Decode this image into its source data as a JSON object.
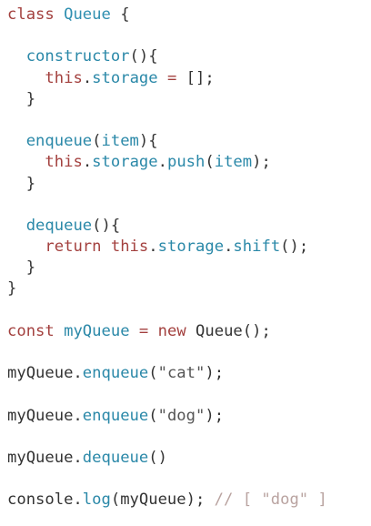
{
  "code": {
    "lines": [
      [
        {
          "t": "class",
          "c": "kw"
        },
        {
          "t": " ",
          "c": "pl"
        },
        {
          "t": "Queue",
          "c": "ty"
        },
        {
          "t": " {",
          "c": "pl"
        }
      ],
      [],
      [
        {
          "t": "  ",
          "c": "pl"
        },
        {
          "t": "constructor",
          "c": "fn"
        },
        {
          "t": "(){",
          "c": "pl"
        }
      ],
      [
        {
          "t": "    ",
          "c": "pl"
        },
        {
          "t": "this",
          "c": "kw"
        },
        {
          "t": ".",
          "c": "pl"
        },
        {
          "t": "storage",
          "c": "fn"
        },
        {
          "t": " ",
          "c": "pl"
        },
        {
          "t": "=",
          "c": "kw"
        },
        {
          "t": " [];",
          "c": "pl"
        }
      ],
      [
        {
          "t": "  }",
          "c": "pl"
        }
      ],
      [],
      [
        {
          "t": "  ",
          "c": "pl"
        },
        {
          "t": "enqueue",
          "c": "fn"
        },
        {
          "t": "(",
          "c": "pl"
        },
        {
          "t": "item",
          "c": "fn"
        },
        {
          "t": "){",
          "c": "pl"
        }
      ],
      [
        {
          "t": "    ",
          "c": "pl"
        },
        {
          "t": "this",
          "c": "kw"
        },
        {
          "t": ".",
          "c": "pl"
        },
        {
          "t": "storage",
          "c": "fn"
        },
        {
          "t": ".",
          "c": "pl"
        },
        {
          "t": "push",
          "c": "fn"
        },
        {
          "t": "(",
          "c": "pl"
        },
        {
          "t": "item",
          "c": "fn"
        },
        {
          "t": ");",
          "c": "pl"
        }
      ],
      [
        {
          "t": "  }",
          "c": "pl"
        }
      ],
      [],
      [
        {
          "t": "  ",
          "c": "pl"
        },
        {
          "t": "dequeue",
          "c": "fn"
        },
        {
          "t": "(){",
          "c": "pl"
        }
      ],
      [
        {
          "t": "    ",
          "c": "pl"
        },
        {
          "t": "return",
          "c": "kw"
        },
        {
          "t": " ",
          "c": "pl"
        },
        {
          "t": "this",
          "c": "kw"
        },
        {
          "t": ".",
          "c": "pl"
        },
        {
          "t": "storage",
          "c": "fn"
        },
        {
          "t": ".",
          "c": "pl"
        },
        {
          "t": "shift",
          "c": "fn"
        },
        {
          "t": "();",
          "c": "pl"
        }
      ],
      [
        {
          "t": "  }",
          "c": "pl"
        }
      ],
      [
        {
          "t": "}",
          "c": "pl"
        }
      ],
      [],
      [
        {
          "t": "const",
          "c": "kw"
        },
        {
          "t": " ",
          "c": "pl"
        },
        {
          "t": "myQueue",
          "c": "fn"
        },
        {
          "t": " ",
          "c": "pl"
        },
        {
          "t": "=",
          "c": "kw"
        },
        {
          "t": " ",
          "c": "pl"
        },
        {
          "t": "new",
          "c": "kw"
        },
        {
          "t": " Queue();",
          "c": "pl"
        }
      ],
      [],
      [
        {
          "t": "myQueue.",
          "c": "pl"
        },
        {
          "t": "enqueue",
          "c": "fn"
        },
        {
          "t": "(",
          "c": "pl"
        },
        {
          "t": "\"cat\"",
          "c": "str"
        },
        {
          "t": ");",
          "c": "pl"
        }
      ],
      [],
      [
        {
          "t": "myQueue.",
          "c": "pl"
        },
        {
          "t": "enqueue",
          "c": "fn"
        },
        {
          "t": "(",
          "c": "pl"
        },
        {
          "t": "\"dog\"",
          "c": "str"
        },
        {
          "t": ");",
          "c": "pl"
        }
      ],
      [],
      [
        {
          "t": "myQueue.",
          "c": "pl"
        },
        {
          "t": "dequeue",
          "c": "fn"
        },
        {
          "t": "()",
          "c": "pl"
        }
      ],
      [],
      [
        {
          "t": "console.",
          "c": "pl"
        },
        {
          "t": "log",
          "c": "fn"
        },
        {
          "t": "(myQueue); ",
          "c": "pl"
        },
        {
          "t": "// [ \"dog\" ]",
          "c": "cm"
        }
      ]
    ]
  }
}
